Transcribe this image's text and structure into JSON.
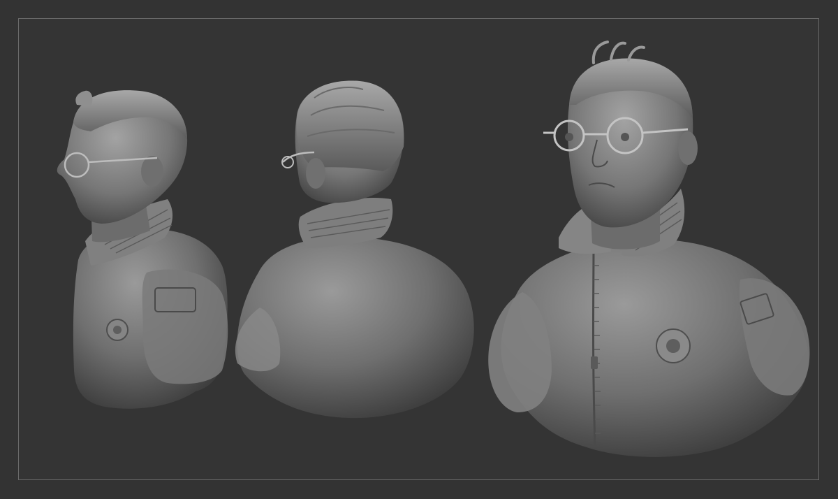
{
  "scene": {
    "background_color": "#333333",
    "frame_color": "#6a6a6a",
    "clay_color": "#8c8c8c",
    "views": [
      {
        "name": "bust-side-view",
        "angle": "profile-left"
      },
      {
        "name": "bust-back-view",
        "angle": "back-three-quarter"
      },
      {
        "name": "bust-front-view",
        "angle": "front-three-quarter"
      }
    ]
  }
}
